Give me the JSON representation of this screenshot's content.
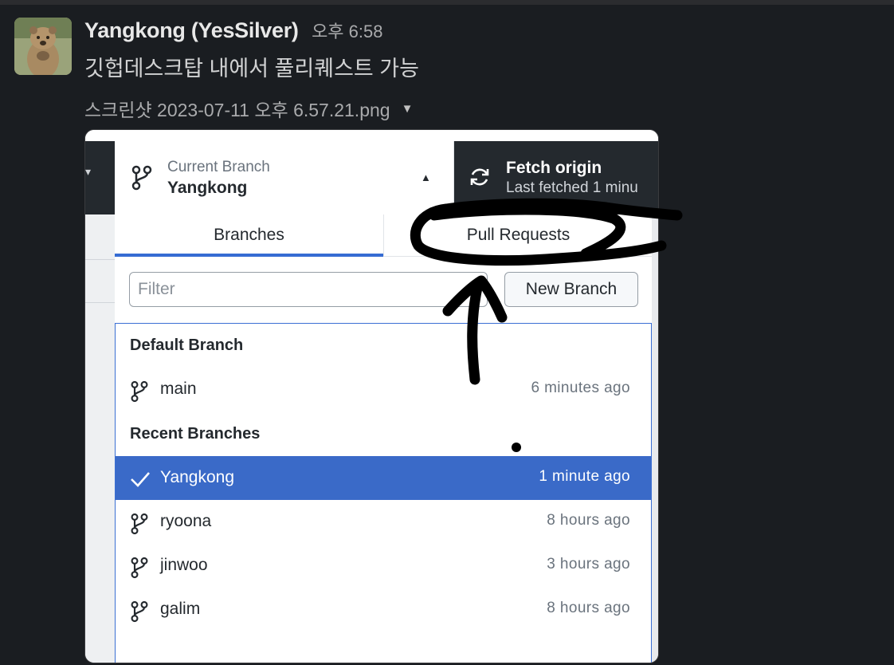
{
  "message": {
    "sender": "Yangkong (YesSilver)",
    "time": "오후 6:58",
    "text": "깃헙데스크탑 내에서 풀리퀘스트 가능",
    "file_name": "스크린샷 2023-07-11 오후 6.57.21.png"
  },
  "screenshot": {
    "current_branch_label": "Current Branch",
    "current_branch": "Yangkong",
    "fetch_title": "Fetch origin",
    "fetch_subtitle": "Last fetched 1 minu",
    "tabs": [
      "Branches",
      "Pull Requests"
    ],
    "filter_placeholder": "Filter",
    "new_branch_label": "New Branch",
    "default_branch_heading": "Default Branch",
    "recent_branches_heading": "Recent Branches",
    "default_branch": {
      "name": "main",
      "time": "6 minutes ago"
    },
    "recent_branches": [
      {
        "name": "Yangkong",
        "time": "1 minute ago",
        "selected": true
      },
      {
        "name": "ryoona",
        "time": "8 hours ago",
        "selected": false
      },
      {
        "name": "jinwoo",
        "time": "3 hours ago",
        "selected": false
      },
      {
        "name": "galim",
        "time": "8 hours ago",
        "selected": false
      }
    ]
  },
  "colors": {
    "background": "#1a1d21",
    "selected_row": "#3a6ac8",
    "tab_underline": "#366cd3",
    "toolbar": "#24292e"
  },
  "icons": [
    "git-branch-icon",
    "sync-icon",
    "checkmark-icon",
    "caret-down-icon",
    "caret-up-icon"
  ]
}
